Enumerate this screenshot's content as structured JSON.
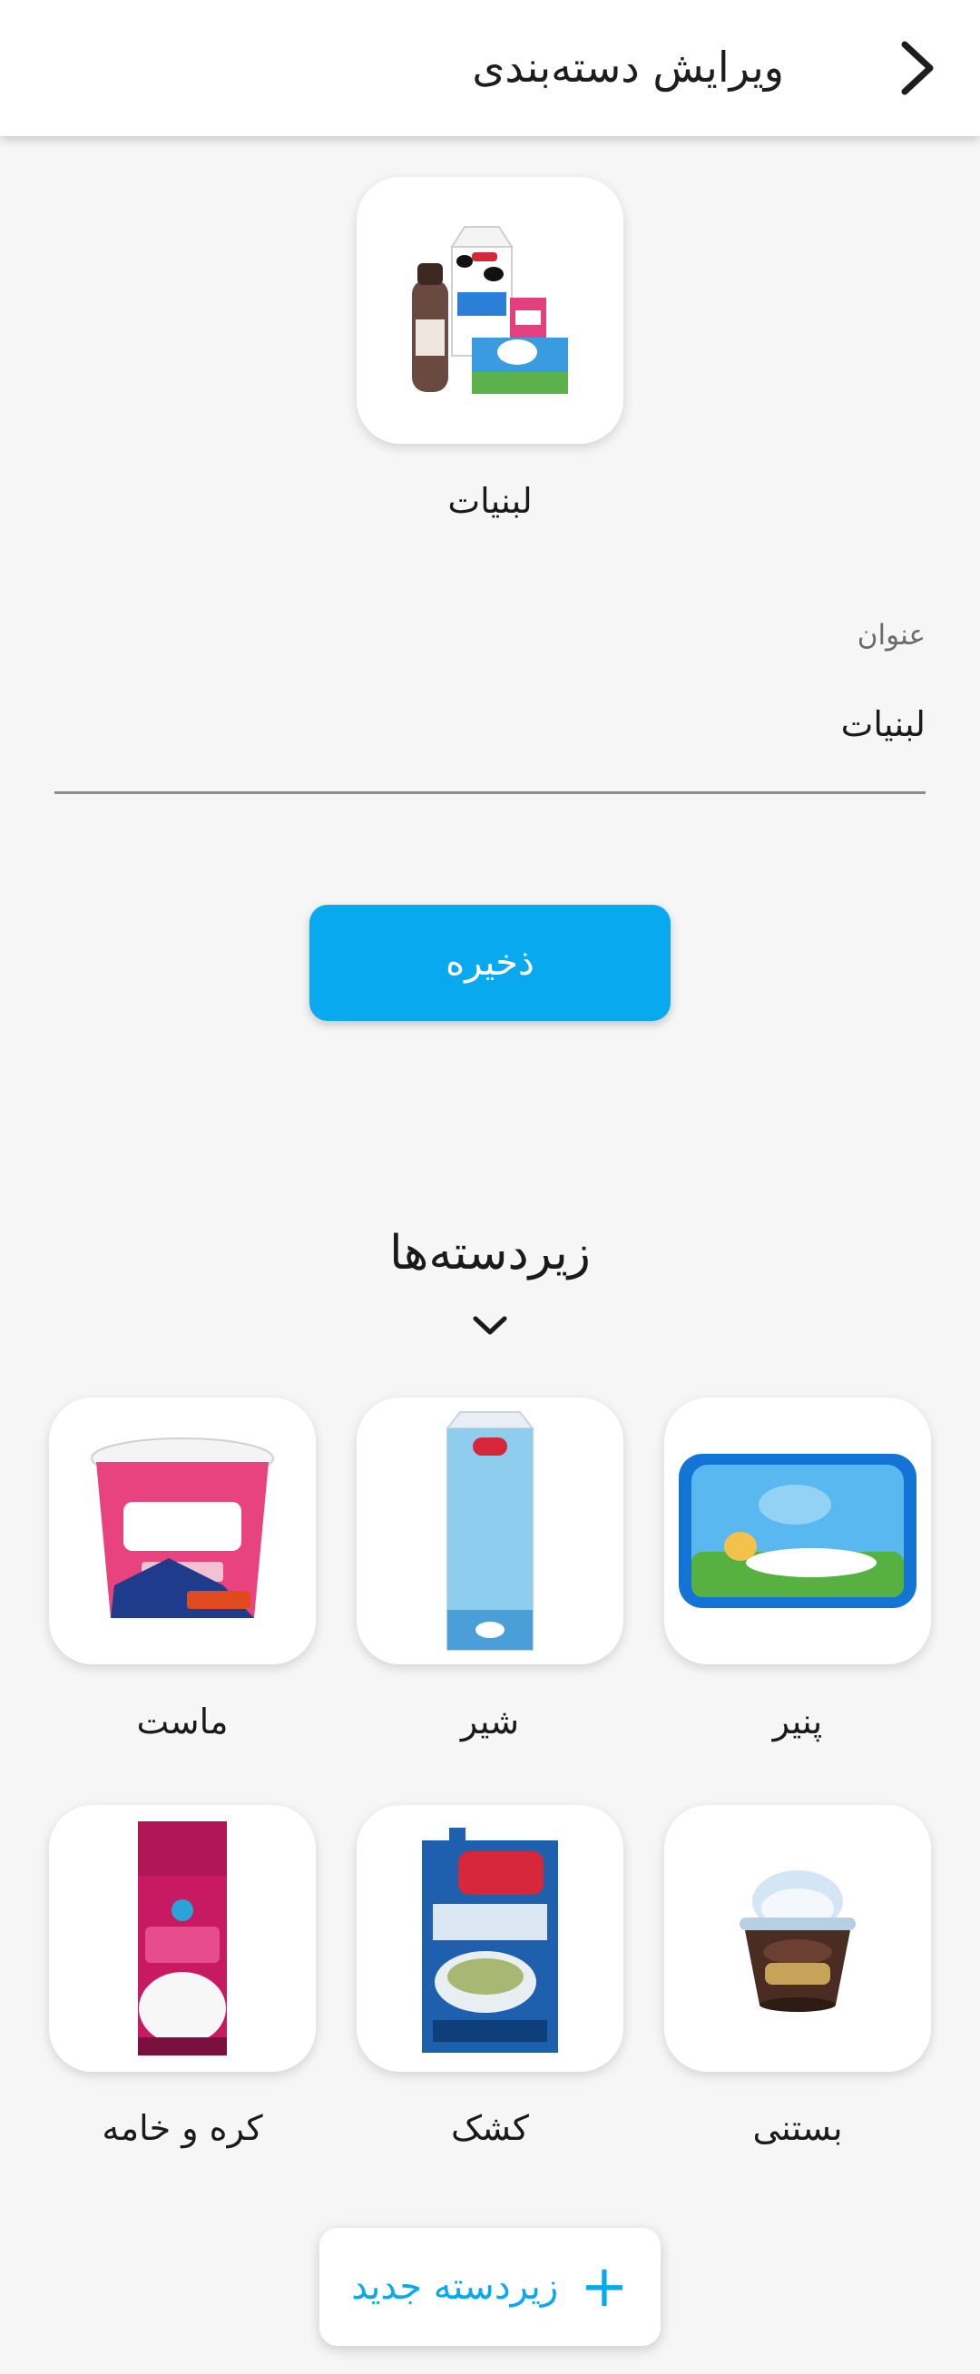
{
  "header": {
    "title": "ویرایش دسته‌بندی",
    "back_icon": "chevron-right-icon"
  },
  "category": {
    "image": "dairy-products-image",
    "name": "لبنیات"
  },
  "form": {
    "field_label": "عنوان",
    "field_value": "لبنیات",
    "save_label": "ذخیره"
  },
  "subcategories": {
    "title": "زیردسته‌ها",
    "toggle_icon": "chevron-down-icon",
    "items": [
      {
        "label": "پنیر",
        "image": "kibi-cheese-image"
      },
      {
        "label": "شیر",
        "image": "milk-carton-image"
      },
      {
        "label": "ماست",
        "image": "yogurt-tub-image"
      },
      {
        "label": "بستنی",
        "image": "ice-cream-cup-image"
      },
      {
        "label": "کشک",
        "image": "kashk-pouch-image"
      },
      {
        "label": "کره و خامه",
        "image": "cream-carton-image"
      }
    ],
    "add_label": "زیردسته جدید",
    "add_icon": "plus-icon"
  },
  "colors": {
    "accent": "#09a9f0",
    "background": "#f6f6f6",
    "card": "#ffffff"
  }
}
